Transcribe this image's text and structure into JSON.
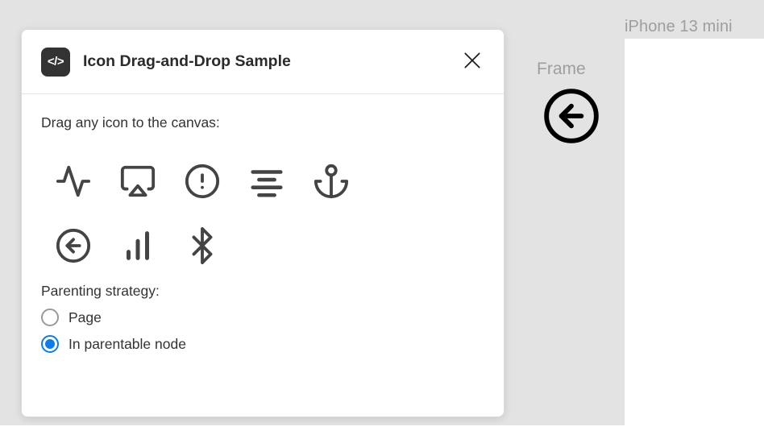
{
  "canvas": {
    "background_color": "#e3e3e3",
    "frame_group": {
      "label": "Frame",
      "icon": "arrow-left-circle-icon"
    },
    "device_frame": {
      "label": "iPhone 13 mini",
      "background_color": "#ffffff",
      "placed_icon": "anchor-icon"
    }
  },
  "dialog": {
    "logo_glyph": "</>",
    "logo_icon": "code-brackets-icon",
    "title": "Icon Drag-and-Drop Sample",
    "close_label": "×",
    "close_icon": "close-icon",
    "instruction": "Drag any icon to the canvas:",
    "icons": [
      {
        "name": "activity-icon",
        "label": "Activity"
      },
      {
        "name": "airplay-icon",
        "label": "Airplay"
      },
      {
        "name": "alert-circle-icon",
        "label": "Alert Circle"
      },
      {
        "name": "align-center-icon",
        "label": "Align Center"
      },
      {
        "name": "anchor-icon",
        "label": "Anchor"
      },
      {
        "name": "arrow-left-circle-icon",
        "label": "Arrow Left Circle"
      },
      {
        "name": "bar-chart-icon",
        "label": "Bar Chart"
      },
      {
        "name": "bluetooth-icon",
        "label": "Bluetooth"
      }
    ],
    "parenting": {
      "label": "Parenting strategy:",
      "options": [
        {
          "label": "Page",
          "selected": false
        },
        {
          "label": "In parentable node",
          "selected": true
        }
      ],
      "accent_color": "#0b7cf0"
    }
  }
}
